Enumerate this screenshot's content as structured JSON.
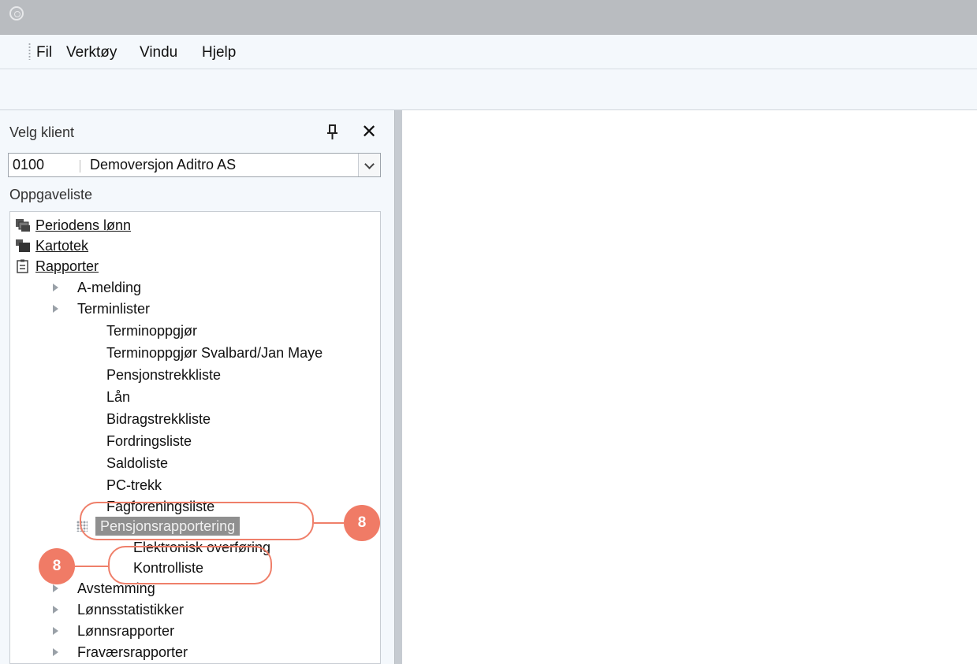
{
  "menu": {
    "items": [
      {
        "label": "Fil"
      },
      {
        "label": "Verktøy"
      },
      {
        "label": "Vindu"
      },
      {
        "label": "Hjelp"
      }
    ]
  },
  "panel": {
    "title": "Velg klient",
    "client": {
      "code": "0100",
      "name": "Demoversjon Aditro AS"
    },
    "task_heading": "Oppgaveliste"
  },
  "tree": {
    "periodens_lonn": "Periodens lønn",
    "kartotek": "Kartotek",
    "rapporter": "Rapporter",
    "a_melding": "A-melding",
    "terminlister": "Terminlister",
    "terminoppgjor": "Terminoppgjør",
    "terminoppgjor_svalbard": "Terminoppgjør Svalbard/Jan Maye",
    "pensjonstrekkliste": "Pensjonstrekkliste",
    "lan": "Lån",
    "bidragstrekkliste": "Bidragstrekkliste",
    "fordringsliste": "Fordringsliste",
    "saldoliste": "Saldoliste",
    "pc_trekk": "PC-trekk",
    "fagforeningsliste": "Fagforeningsliste",
    "pensjonsrapportering": "Pensjonsrapportering",
    "elektronisk_overforing": "Elektronisk overføring",
    "kontrolliste": "Kontrolliste",
    "avstemming": "Avstemming",
    "lonnsstatistikker": "Lønnsstatistikker",
    "lonnsrapporter": "Lønnsrapporter",
    "fravaersrapporter": "Fraværsrapporter"
  },
  "callouts": {
    "first": "8",
    "second": "8"
  },
  "colors": {
    "accent": "#f07b66",
    "selection": "#8f8f8f"
  }
}
